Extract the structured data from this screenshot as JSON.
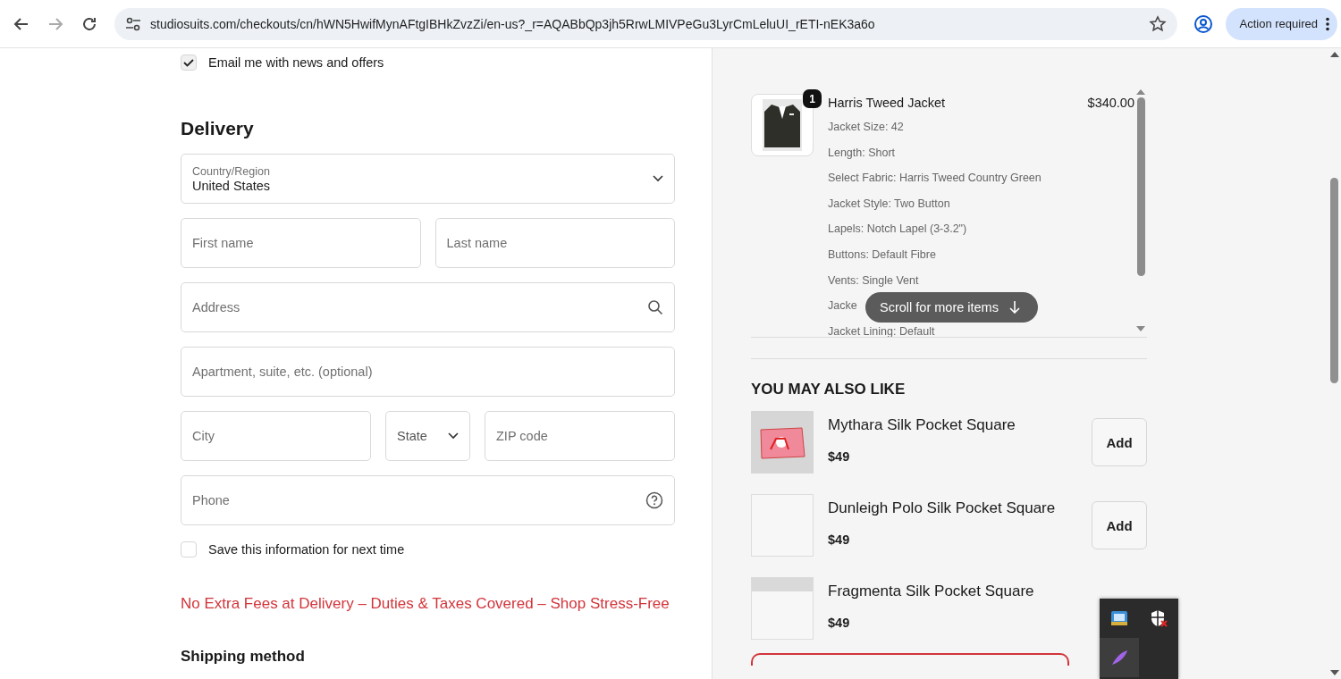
{
  "browser": {
    "url": "studiosuits.com/checkouts/cn/hWN5HwifMynAFtgIBHkZvzZi/en-us?_r=AQABbQp3jh5RrwLMIVPeGu3LyrCmLeluUI_rETI-nEK3a6o",
    "action_button": "Action required"
  },
  "form": {
    "email_news": {
      "label": "Email me with news and offers",
      "checked": true
    },
    "title": "Delivery",
    "country": {
      "label": "Country/Region",
      "value": "United States"
    },
    "rows": [
      [
        {
          "kind": "text",
          "placeholder": "First name"
        },
        {
          "kind": "text",
          "placeholder": "Last name"
        }
      ],
      [
        {
          "kind": "search",
          "placeholder": "Address"
        }
      ],
      [
        {
          "kind": "text",
          "placeholder": "Apartment, suite, etc. (optional)"
        }
      ],
      [
        {
          "kind": "text",
          "placeholder": "City"
        },
        {
          "kind": "select",
          "placeholder": "State"
        },
        {
          "kind": "text",
          "placeholder": "ZIP code"
        }
      ],
      [
        {
          "kind": "help",
          "placeholder": "Phone"
        }
      ]
    ],
    "save_info": {
      "label": "Save this information for next time",
      "checked": false
    },
    "notice": "No Extra Fees at Delivery – Duties & Taxes Covered – Shop Stress-Free",
    "shipping_title": "Shipping method"
  },
  "order": {
    "items": [
      {
        "name": "Harris Tweed Jacket",
        "quantity": "1",
        "price": "$340.00",
        "options": [
          "Jacket Size: 42",
          "Length: Short",
          "Select Fabric: Harris Tweed Country Green",
          "Jacket Style: Two Button",
          "Lapels: Notch Lapel (3-3.2\")",
          "Buttons: Default Fibre",
          "Vents: Single Vent",
          "Jacke",
          "Jacket Lining: Default"
        ]
      }
    ],
    "scroll_hint": "Scroll for more items"
  },
  "recommendations": {
    "title": "YOU MAY ALSO LIKE",
    "items": [
      {
        "name": "Mythara Silk Pocket Square",
        "price": "$49",
        "kind": "photo",
        "button": "Add"
      },
      {
        "name": "Dunleigh Polo Silk Pocket Square",
        "price": "$49",
        "kind": "empty",
        "button": "Add"
      },
      {
        "name": "Fragmenta Silk Pocket Square",
        "price": "$49",
        "kind": "loading"
      }
    ]
  }
}
